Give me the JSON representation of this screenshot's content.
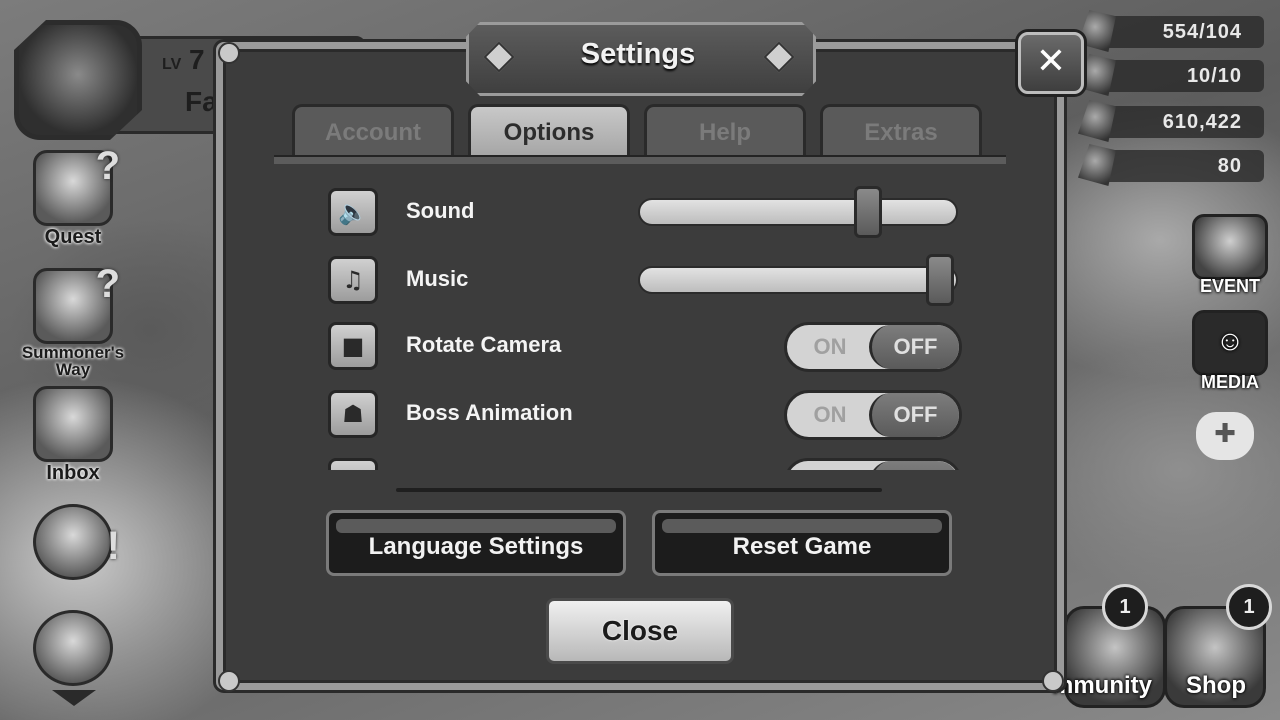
{
  "hud": {
    "level_prefix": "LV",
    "level_value": "7",
    "player_name": "Fa",
    "side_menu": [
      {
        "label": "Quest"
      },
      {
        "label": "Summoner's Way"
      },
      {
        "label": "Inbox"
      }
    ],
    "resources": [
      {
        "value": "554/104",
        "icon": "energy-icon"
      },
      {
        "value": "10/10",
        "icon": "arena-wing-icon"
      },
      {
        "value": "610,422",
        "icon": "mana-crystal-icon"
      },
      {
        "value": "80",
        "icon": "crystal-icon"
      }
    ],
    "right_menu": [
      {
        "label": "EVENT"
      },
      {
        "label": "MEDIA"
      }
    ],
    "bottom_menu": [
      {
        "label": "mmunity",
        "badge": "1"
      },
      {
        "label": "Shop",
        "badge": "1"
      }
    ]
  },
  "settings": {
    "title": "Settings",
    "close_x": "✕",
    "tabs": [
      {
        "label": "Account",
        "active": false
      },
      {
        "label": "Options",
        "active": true
      },
      {
        "label": "Help",
        "active": false
      },
      {
        "label": "Extras",
        "active": false
      }
    ],
    "options": [
      {
        "label": "Sound",
        "type": "slider",
        "value": 0.72,
        "icon": "speaker-icon"
      },
      {
        "label": "Music",
        "type": "slider",
        "value": 0.95,
        "icon": "music-note-icon"
      },
      {
        "label": "Rotate Camera",
        "type": "toggle",
        "on_label": "ON",
        "off_label": "OFF",
        "state": "OFF",
        "icon": "camera-icon"
      },
      {
        "label": "Boss Animation",
        "type": "toggle",
        "on_label": "ON",
        "off_label": "OFF",
        "state": "OFF",
        "icon": "boss-face-icon"
      }
    ],
    "language_button": "Language Settings",
    "reset_button": "Reset Game",
    "close_button": "Close"
  }
}
